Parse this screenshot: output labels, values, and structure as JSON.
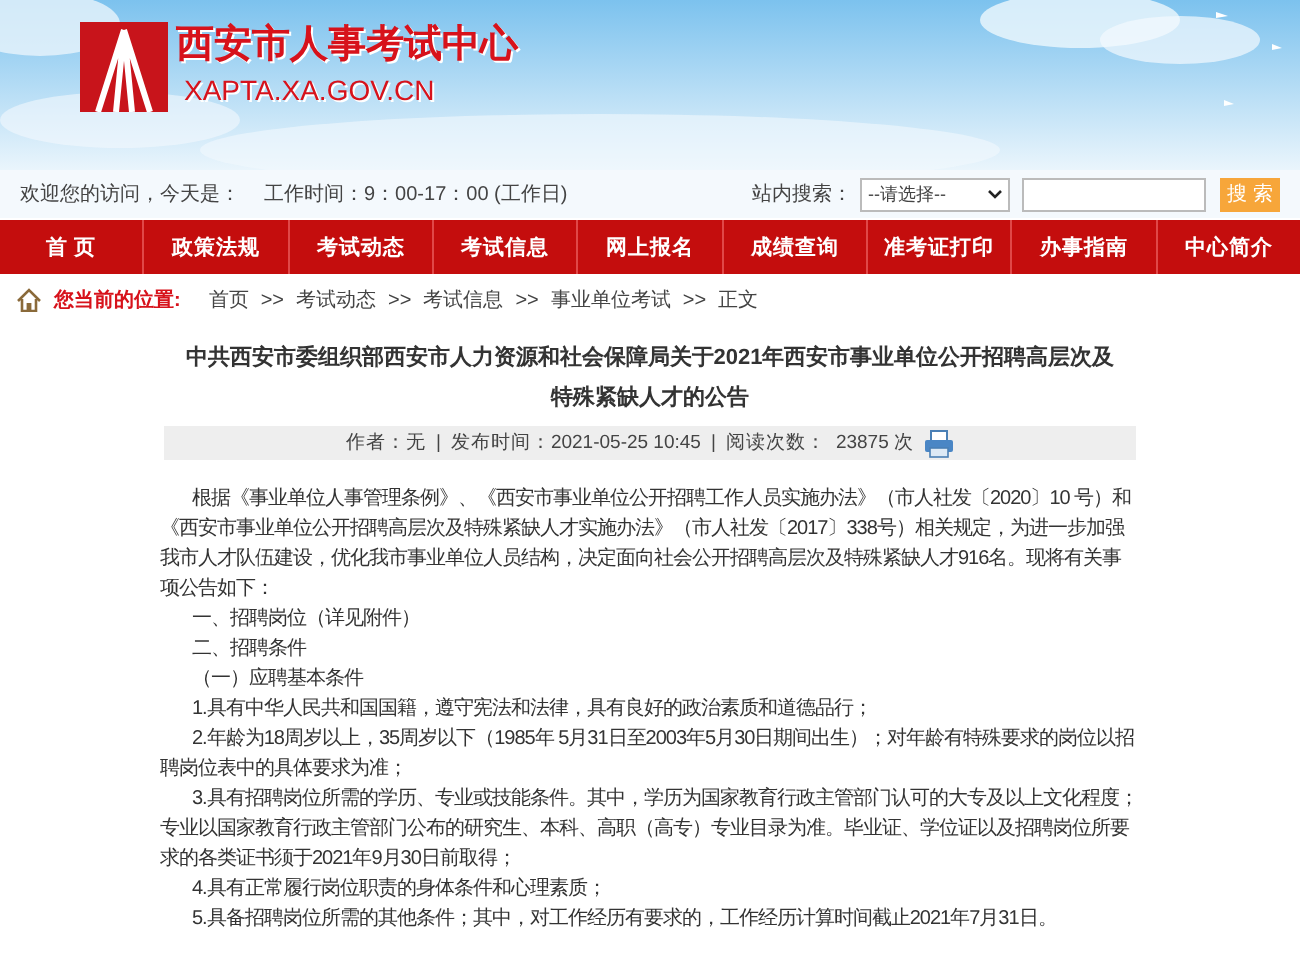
{
  "header": {
    "site_name": "西安市人事考试中心",
    "domain": "XAPTA.XA.GOV.CN"
  },
  "info_bar": {
    "welcome": "欢迎您的访问，今天是：",
    "hours": "工作时间：9：00-17：00 (工作日)",
    "search_label": "站内搜索：",
    "search_select": "--请选择--",
    "search_button": "搜 索"
  },
  "nav": [
    {
      "label": "首 页"
    },
    {
      "label": "政策法规"
    },
    {
      "label": "考试动态"
    },
    {
      "label": "考试信息"
    },
    {
      "label": "网上报名"
    },
    {
      "label": "成绩查询"
    },
    {
      "label": "准考证打印"
    },
    {
      "label": "办事指南"
    },
    {
      "label": "中心简介"
    }
  ],
  "breadcrumb": {
    "label": "您当前的位置:",
    "items": [
      {
        "label": "首页"
      },
      {
        "separator": ">>",
        "label": "考试动态"
      },
      {
        "separator": ">>",
        "label": "考试信息"
      },
      {
        "separator": ">>",
        "label": "事业单位考试"
      },
      {
        "separator": ">>",
        "label": "正文"
      }
    ]
  },
  "article": {
    "title": "中共西安市委组织部西安市人力资源和社会保障局关于2021年西安市事业单位公开招聘高层次及特殊紧缺人才的公告",
    "meta": {
      "separator_1": "|",
      "separator_2": "|",
      "author": "作者：无",
      "published": "发布时间：2021-05-25 10:45",
      "views_label": "阅读次数：",
      "views": "23875 次"
    },
    "paragraphs": [
      "根据《事业单位人事管理条例》、《西安市事业单位公开招聘工作人员实施办法》（市人社发〔2020〕10 号）和《西安市事业单位公开招聘高层次及特殊紧缺人才实施办法》（市人社发〔2017〕338号）相关规定，为进一步加强我市人才队伍建设，优化我市事业单位人员结构，决定面向社会公开招聘高层次及特殊紧缺人才916名。现将有关事项公告如下：",
      "一、招聘岗位（详见附件）",
      "二、招聘条件",
      "（一）应聘基本条件",
      "1.具有中华人民共和国国籍，遵守宪法和法律，具有良好的政治素质和道德品行；",
      "2.年龄为18周岁以上，35周岁以下（1985年 5月31日至2003年5月30日期间出生）；对年龄有特殊要求的岗位以招聘岗位表中的具体要求为准；",
      "3.具有招聘岗位所需的学历、专业或技能条件。其中，学历为国家教育行政主管部门认可的大专及以上文化程度；专业以国家教育行政主管部门公布的研究生、本科、高职（高专）专业目录为准。毕业证、学位证以及招聘岗位所要求的各类证书须于2021年9月30日前取得；",
      "4.具有正常履行岗位职责的身体条件和心理素质；",
      "5.具备招聘岗位所需的其他条件；其中，对工作经历有要求的，工作经历计算时间截止2021年7月31日。"
    ]
  }
}
